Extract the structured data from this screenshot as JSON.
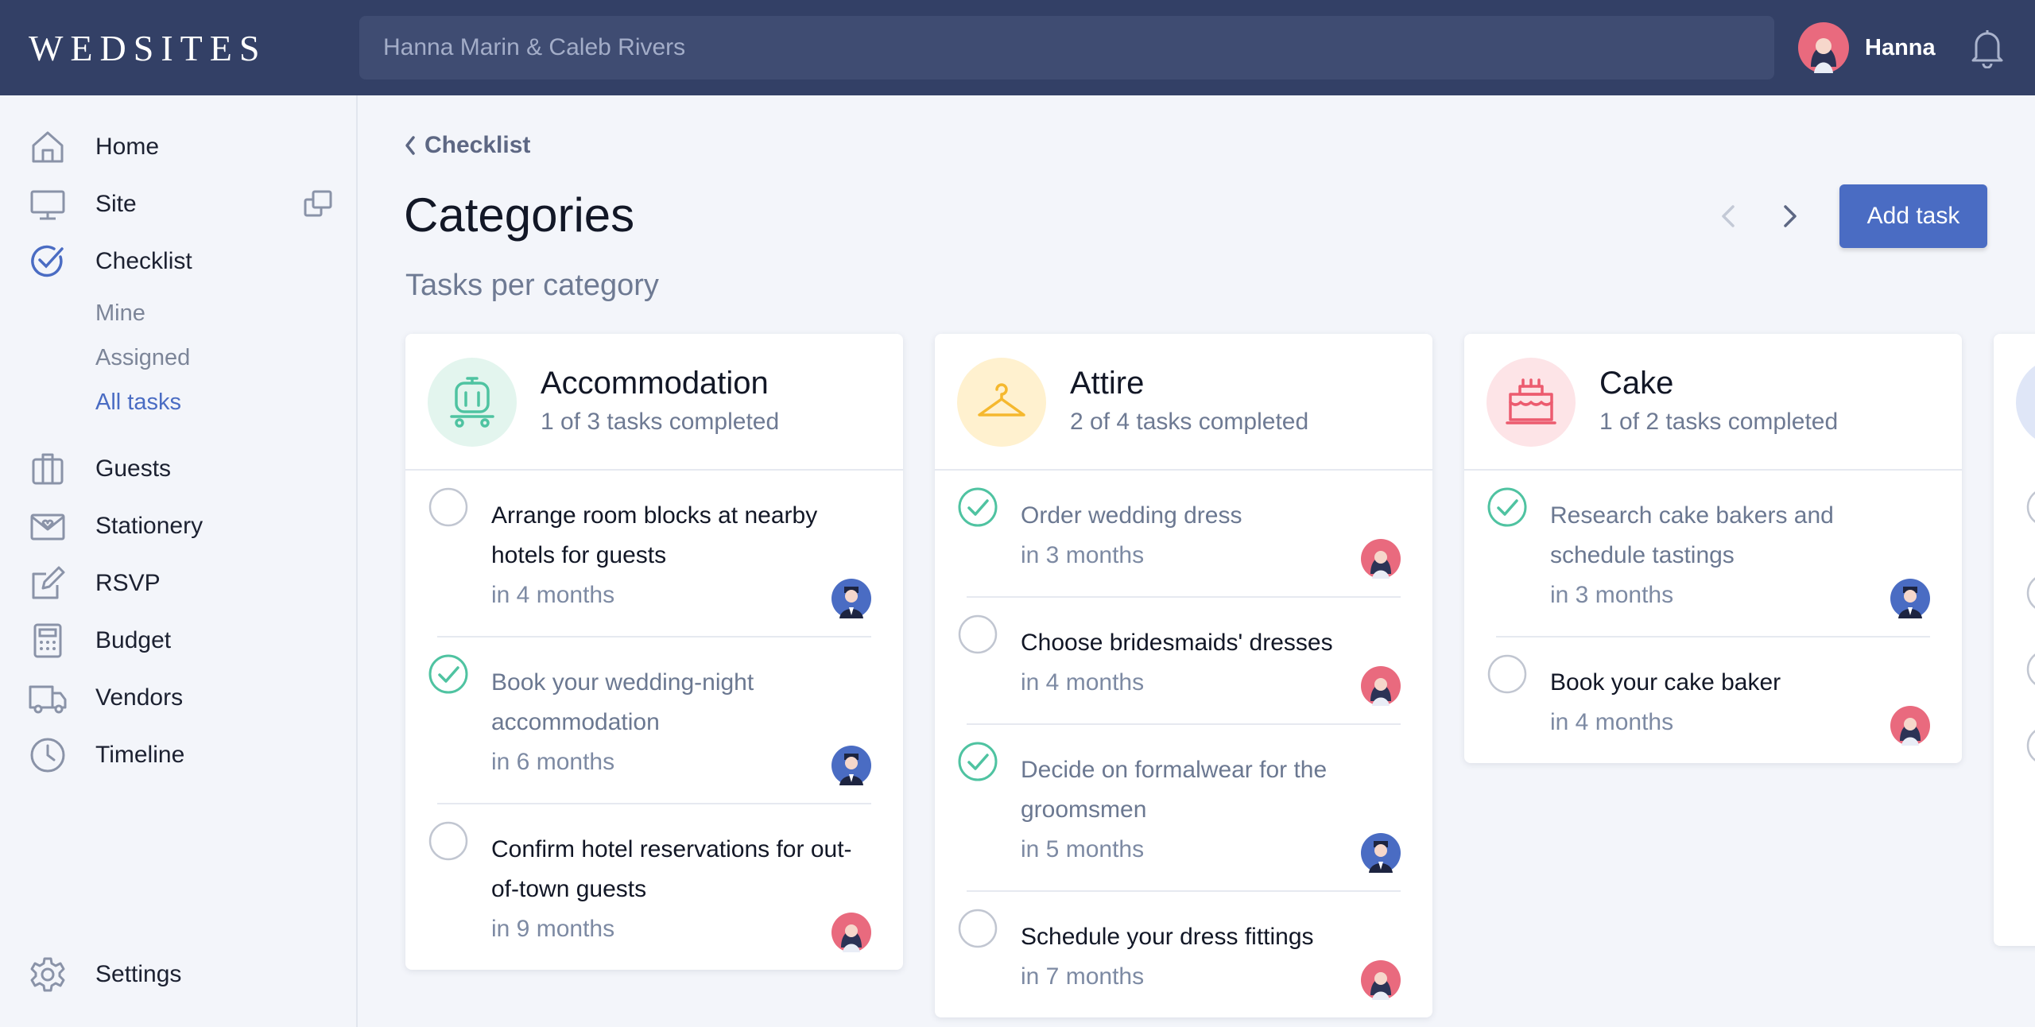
{
  "app": {
    "logo": "WEDSITES",
    "search_placeholder": "Hanna Marin & Caleb Rivers",
    "user_name": "Hanna"
  },
  "sidebar": {
    "items": [
      {
        "label": "Home",
        "icon": "home-icon"
      },
      {
        "label": "Site",
        "icon": "monitor-icon"
      },
      {
        "label": "Checklist",
        "icon": "checklist-icon"
      },
      {
        "label": "Guests",
        "icon": "guests-icon"
      },
      {
        "label": "Stationery",
        "icon": "stationery-icon"
      },
      {
        "label": "RSVP",
        "icon": "rsvp-icon"
      },
      {
        "label": "Budget",
        "icon": "calculator-icon"
      },
      {
        "label": "Vendors",
        "icon": "truck-icon"
      },
      {
        "label": "Timeline",
        "icon": "clock-icon"
      }
    ],
    "checklist_sub": [
      "Mine",
      "Assigned",
      "All tasks"
    ],
    "active_sub": "All tasks",
    "settings_label": "Settings"
  },
  "main": {
    "breadcrumb": "Checklist",
    "title": "Categories",
    "subtitle": "Tasks per category",
    "add_task_label": "Add task"
  },
  "colors": {
    "accent": "#4a6cc3",
    "topbar": "#334066",
    "done_check": "#4fc3a1",
    "accommodation_bg": "#e3f5ee",
    "attire_bg": "#fff1cf",
    "cake_bg": "#fde4e7"
  },
  "categories": [
    {
      "name": "Accommodation",
      "progress": "1 of 3 tasks completed",
      "icon": "luggage-cart-icon",
      "tasks": [
        {
          "title": "Arrange room blocks at nearby hotels for guests",
          "due": "in 4 months",
          "done": false,
          "assignee": "groom"
        },
        {
          "title": "Book your wedding-night accommodation",
          "due": "in 6 months",
          "done": true,
          "assignee": "groom"
        },
        {
          "title": "Confirm hotel reservations for out-of-town guests",
          "due": "in 9 months",
          "done": false,
          "assignee": "bride"
        }
      ]
    },
    {
      "name": "Attire",
      "progress": "2 of 4 tasks completed",
      "icon": "hanger-icon",
      "tasks": [
        {
          "title": "Order wedding dress",
          "due": "in 3 months",
          "done": true,
          "assignee": "bride"
        },
        {
          "title": "Choose bridesmaids' dresses",
          "due": "in 4 months",
          "done": false,
          "assignee": "bride"
        },
        {
          "title": "Decide on formalwear for the groomsmen",
          "due": "in 5 months",
          "done": true,
          "assignee": "groom"
        },
        {
          "title": "Schedule your dress fittings",
          "due": "in 7 months",
          "done": false,
          "assignee": "bride"
        }
      ]
    },
    {
      "name": "Cake",
      "progress": "1 of 2 tasks completed",
      "icon": "cake-icon",
      "tasks": [
        {
          "title": "Research cake bakers and schedule tastings",
          "due": "in 3 months",
          "done": true,
          "assignee": "groom"
        },
        {
          "title": "Book your cake baker",
          "due": "in 4 months",
          "done": false,
          "assignee": "bride"
        }
      ]
    }
  ]
}
